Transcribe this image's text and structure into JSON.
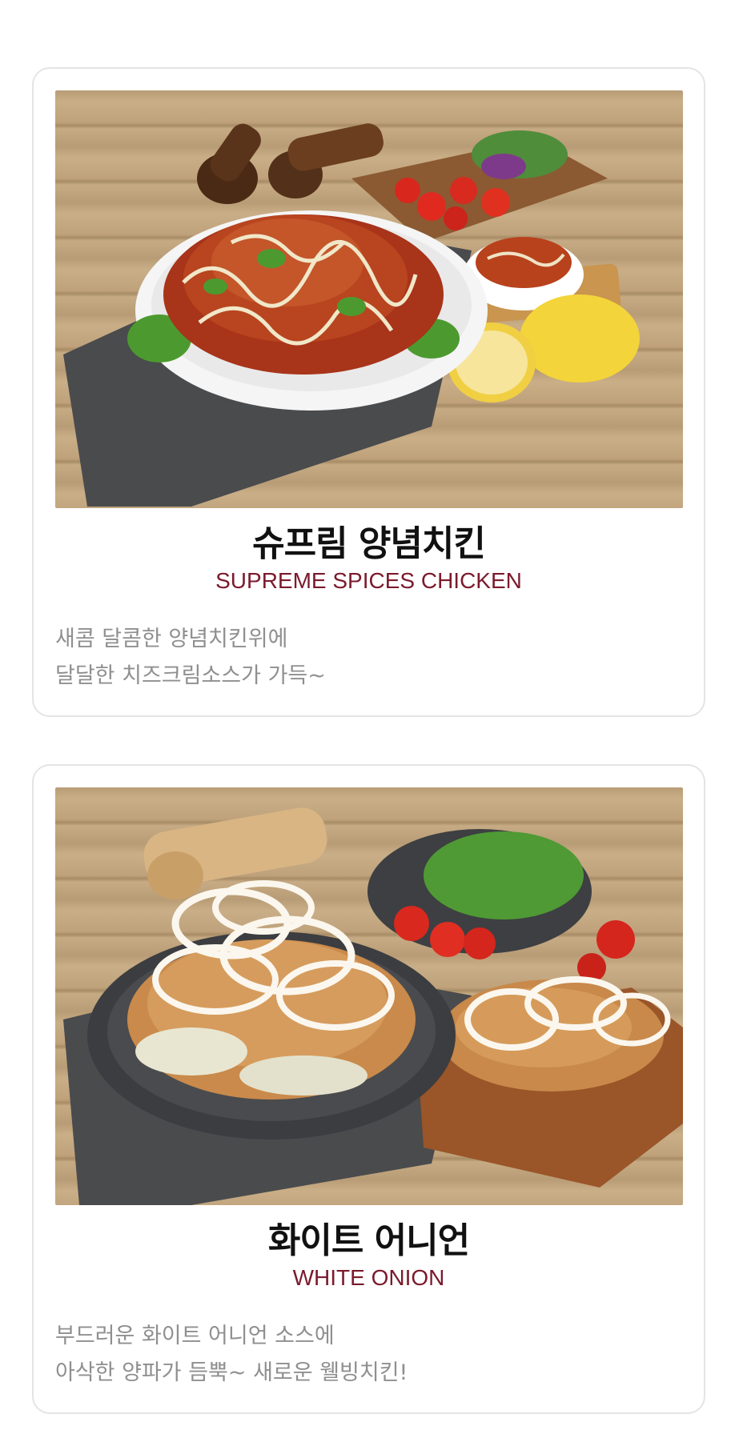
{
  "menu_items": [
    {
      "title": "슈프림 양념치킨",
      "subtitle": "SUPREME SPICES CHICKEN",
      "description": [
        "새콤 달콤한 양념치킨위에",
        "달달한 치즈크림소스가 가득~"
      ]
    },
    {
      "title": "화이트 어니언",
      "subtitle": "WHITE ONION",
      "description": [
        "부드러운 화이트 어니언 소스에",
        "아삭한 양파가 듬뿍~ 새로운 웰빙치킨!"
      ]
    }
  ],
  "colors": {
    "subtitle_accent": "#7b1a2c",
    "description_text": "#8f8f8f",
    "card_border": "#e4e4e4"
  }
}
